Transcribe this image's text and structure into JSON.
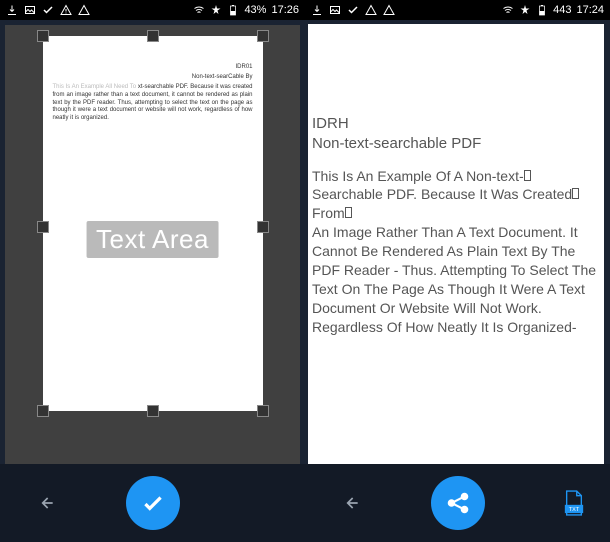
{
  "left": {
    "statusbar": {
      "battery": "43%",
      "time": "17:26"
    },
    "page": {
      "header1": "IDR01",
      "header2_prefix": "Non-text-sear",
      "header2_suffix": "Cable By",
      "body_prefix": "This Is An Example All Need To",
      "body_main": "xt-searchable PDF. Because it was created from an image rather than a text document, it cannot be rendered as plain text by the PDF reader. Thus, attempting to select the text on the page as though it were a text document or website will not work, regardless of how neatly it is organized."
    },
    "overlay_label": "Text Area"
  },
  "right": {
    "statusbar": {
      "battery": "443",
      "time": "17:24"
    },
    "result": {
      "title": "IDRH",
      "subtitle": "Non-text-searchable PDF",
      "para1": "This Is An Example Of A Non-text-",
      "para2": "Searchable PDF. Because It Was Created",
      "para3": "From",
      "para4": "An Image Rather Than A Text Document. It Cannot Be Rendered As Plain Text By The PDF Reader - Thus. Attempting To Select The Text On The Page As Though It Were A Text Document Or Website Will Not Work. Regardless Of How Neatly It Is Organized-"
    },
    "txt_badge": "TXT"
  }
}
